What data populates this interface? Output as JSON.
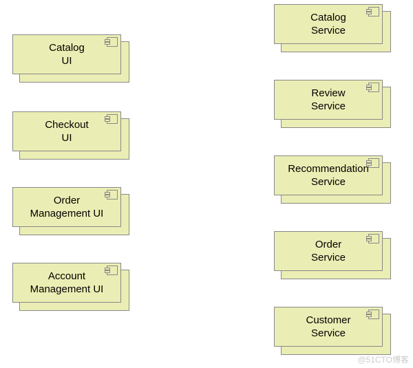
{
  "left_components": [
    {
      "label": "Catalog\nUI"
    },
    {
      "label": "Checkout\nUI"
    },
    {
      "label": "Order\nManagement UI"
    },
    {
      "label": "Account\nManagement UI"
    }
  ],
  "right_components": [
    {
      "label": "Catalog\nService"
    },
    {
      "label": "Review\nService"
    },
    {
      "label": "Recommendation\nService"
    },
    {
      "label": "Order\nService"
    },
    {
      "label": "Customer\nService"
    }
  ],
  "watermark": "@51CTO博客",
  "colors": {
    "box_fill": "#ebeeb4",
    "box_border": "#888888"
  }
}
